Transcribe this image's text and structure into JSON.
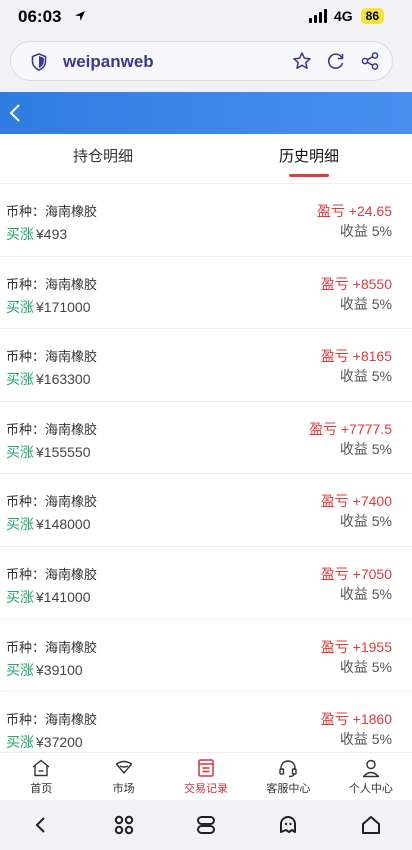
{
  "status_bar": {
    "time": "06:03",
    "network": "4G",
    "battery": "86"
  },
  "browser": {
    "url": "weipanweb"
  },
  "tabs": [
    {
      "label": "持仓明细",
      "active": false
    },
    {
      "label": "历史明细",
      "active": true
    }
  ],
  "records": [
    {
      "label": "币种：海南橡胶",
      "direction": "买涨",
      "amount": "¥493",
      "pnl": "盈亏 +24.65",
      "yield": "收益  5%"
    },
    {
      "label": "币种：海南橡胶",
      "direction": "买涨",
      "amount": "¥171000",
      "pnl": "盈亏 +8550",
      "yield": "收益  5%"
    },
    {
      "label": "币种：海南橡胶",
      "direction": "买涨",
      "amount": "¥163300",
      "pnl": "盈亏 +8165",
      "yield": "收益  5%"
    },
    {
      "label": "币种：海南橡胶",
      "direction": "买涨",
      "amount": "¥155550",
      "pnl": "盈亏 +7777.5",
      "yield": "收益  5%"
    },
    {
      "label": "币种：海南橡胶",
      "direction": "买涨",
      "amount": "¥148000",
      "pnl": "盈亏 +7400",
      "yield": "收益  5%"
    },
    {
      "label": "币种：海南橡胶",
      "direction": "买涨",
      "amount": "¥141000",
      "pnl": "盈亏 +7050",
      "yield": "收益  5%"
    },
    {
      "label": "币种：海南橡胶",
      "direction": "买涨",
      "amount": "¥39100",
      "pnl": "盈亏 +1955",
      "yield": "收益  5%"
    },
    {
      "label": "币种：海南橡胶",
      "direction": "买涨",
      "amount": "¥37200",
      "pnl": "盈亏 +1860",
      "yield": "收益  5%"
    }
  ],
  "bottom_nav": [
    {
      "label": "首页",
      "icon": "home-icon",
      "active": false
    },
    {
      "label": "市场",
      "icon": "market-icon",
      "active": false
    },
    {
      "label": "交易记录",
      "icon": "records-icon",
      "active": true
    },
    {
      "label": "客服中心",
      "icon": "headset-icon",
      "active": false
    },
    {
      "label": "个人中心",
      "icon": "user-icon",
      "active": false
    }
  ],
  "colors": {
    "accent_red": "#e23a3a",
    "rise_green": "#23a86b",
    "header_blue": "#2f7de1",
    "nav_active": "#d8323a"
  }
}
